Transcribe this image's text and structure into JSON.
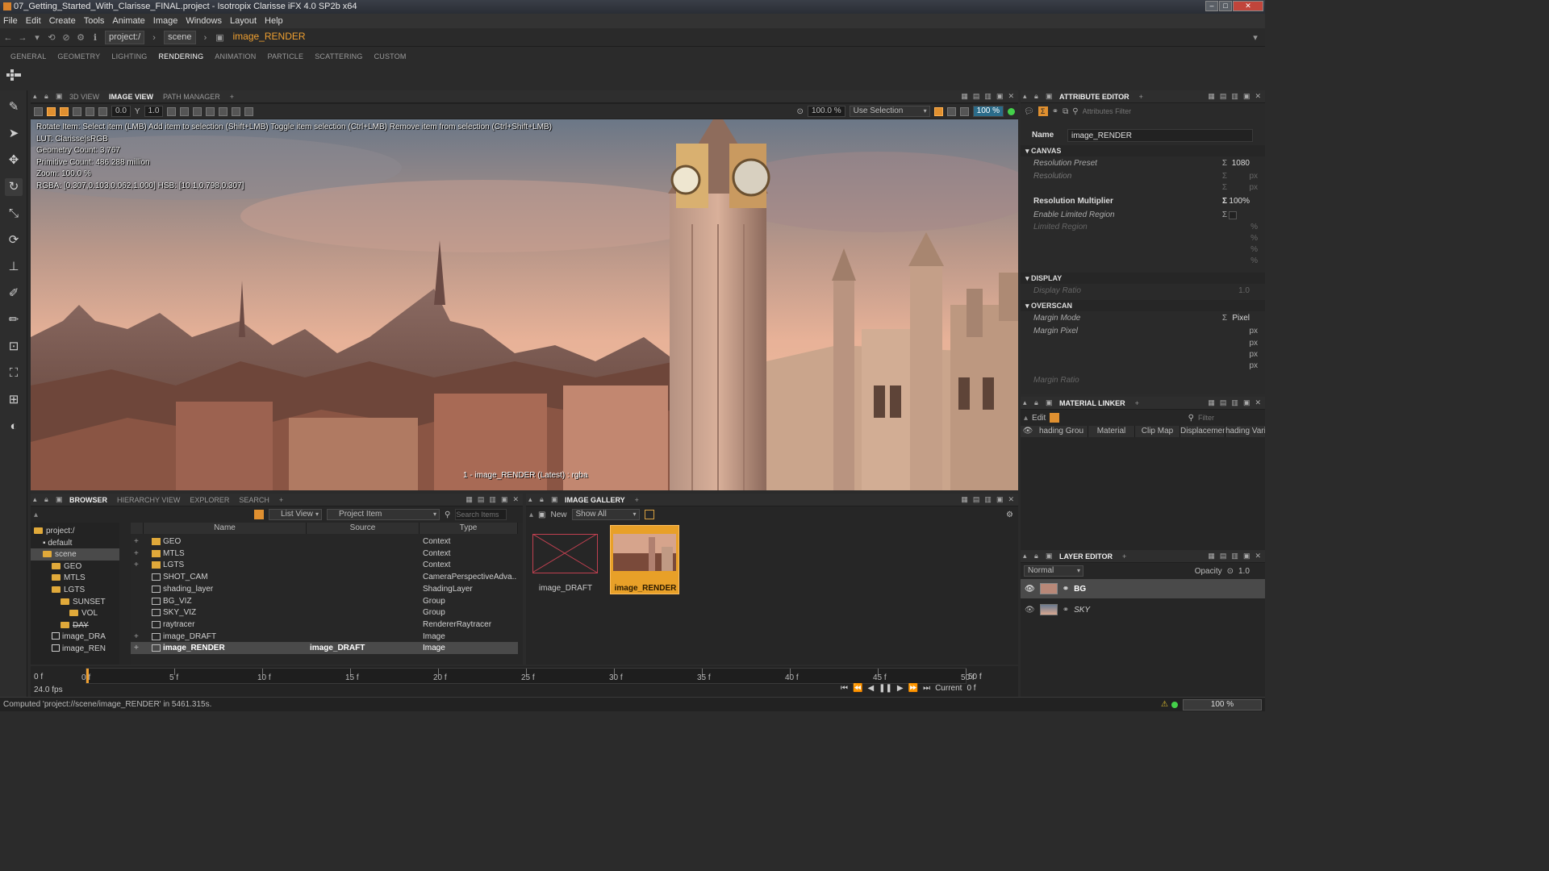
{
  "app": {
    "title": "07_Getting_Started_With_Clarisse_FINAL.project - Isotropix Clarisse iFX 4.0 SP2b x64",
    "window_buttons": [
      "–",
      "□",
      "✕"
    ]
  },
  "menu": [
    "File",
    "Edit",
    "Create",
    "Tools",
    "Animate",
    "Image",
    "Windows",
    "Layout",
    "Help"
  ],
  "path": {
    "crumbs": [
      "project:/",
      "scene"
    ],
    "current": "image_RENDER"
  },
  "shelf_tabs": [
    "GENERAL",
    "GEOMETRY",
    "LIGHTING",
    "RENDERING",
    "ANIMATION",
    "PARTICLE",
    "SCATTERING",
    "CUSTOM"
  ],
  "shelf_active": "RENDERING",
  "viewer": {
    "tabs": [
      "3D VIEW",
      "IMAGE VIEW",
      "PATH MANAGER"
    ],
    "active_tab": "IMAGE VIEW",
    "toolbar": {
      "exposure": "0.0",
      "gamma": "1.0",
      "zoom": "100.0 %",
      "selection": "Use Selection",
      "percent": "100 %"
    },
    "overlay": [
      "Rotate Item: Select item (LMB)  Add item to selection (Shift+LMB)  Toggle item selection (Ctrl+LMB)  Remove item from selection (Ctrl+Shift+LMB)",
      "LUT: Clarisse|sRGB",
      "Geometry Count: 3,767",
      "Primitive Count: 486.288 million",
      "Zoom: 100.0 %",
      "RGBA: [0.307,0.103,0.062,1.000] HSB: [10.1,0.798,0.307]"
    ],
    "caption": "1 - image_RENDER (Latest) : rgba"
  },
  "browser": {
    "tabs": [
      "BROWSER",
      "HIERARCHY VIEW",
      "EXPLORER",
      "SEARCH"
    ],
    "active_tab": "BROWSER",
    "view_mode": "List View",
    "filter_type": "Project Item",
    "search_placeholder": "Search Items",
    "tree": [
      {
        "label": "project:/",
        "indent": 0
      },
      {
        "label": "default",
        "indent": 1
      },
      {
        "label": "scene",
        "indent": 1
      },
      {
        "label": "GEO",
        "indent": 2
      },
      {
        "label": "MTLS",
        "indent": 2
      },
      {
        "label": "LGTS",
        "indent": 2
      },
      {
        "label": "SUNSET",
        "indent": 3
      },
      {
        "label": "VOL",
        "indent": 4
      },
      {
        "label": "DAY",
        "indent": 3
      },
      {
        "label": "image_DRA",
        "indent": 2
      },
      {
        "label": "image_REN",
        "indent": 2
      }
    ],
    "columns": [
      "Name",
      "Source",
      "Type"
    ],
    "rows": [
      {
        "name": "GEO",
        "source": "",
        "type": "Context",
        "icon": "folder"
      },
      {
        "name": "MTLS",
        "source": "",
        "type": "Context",
        "icon": "folder"
      },
      {
        "name": "LGTS",
        "source": "",
        "type": "Context",
        "icon": "folder"
      },
      {
        "name": "SHOT_CAM",
        "source": "",
        "type": "CameraPerspectiveAdva...",
        "icon": "camera"
      },
      {
        "name": "shading_layer",
        "source": "",
        "type": "ShadingLayer",
        "icon": "layer"
      },
      {
        "name": "BG_VIZ",
        "source": "",
        "type": "Group",
        "icon": "group"
      },
      {
        "name": "SKY_VIZ",
        "source": "",
        "type": "Group",
        "icon": "group"
      },
      {
        "name": "raytracer",
        "source": "",
        "type": "RendererRaytracer",
        "icon": "renderer"
      },
      {
        "name": "image_DRAFT",
        "source": "",
        "type": "Image",
        "icon": "image"
      },
      {
        "name": "image_RENDER",
        "source": "image_DRAFT",
        "type": "Image",
        "icon": "image"
      }
    ]
  },
  "gallery": {
    "tab": "IMAGE GALLERY",
    "new_label": "New",
    "filter": "Show All",
    "items": [
      "image_DRAFT",
      "image_RENDER"
    ]
  },
  "attribute_editor": {
    "tab": "ATTRIBUTE EDITOR",
    "filter_placeholder": "Attributes Filter",
    "name_label": "Name",
    "name_value": "image_RENDER",
    "sections": {
      "canvas": "CANVAS",
      "display": "DISPLAY",
      "overscan": "OVERSCAN"
    },
    "attrs": {
      "resolution_preset": "Resolution Preset",
      "resolution_preset_value": "1080",
      "resolution": "Resolution",
      "resolution_multiplier": "Resolution Multiplier",
      "resolution_multiplier_value": "100%",
      "enable_limited_region": "Enable Limited Region",
      "limited_region": "Limited Region",
      "display_ratio": "Display Ratio",
      "display_ratio_value": "1.0",
      "margin_mode": "Margin Mode",
      "margin_mode_value": "Pixel",
      "margin_pixel": "Margin Pixel",
      "margin_ratio": "Margin Ratio",
      "px": "px",
      "pct": "%"
    }
  },
  "material_linker": {
    "tab": "MATERIAL LINKER",
    "edit_label": "Edit",
    "filter_placeholder": "Filter",
    "columns": [
      "hading Grou",
      "Material",
      "Clip Map",
      "Displacement",
      "hading Varia"
    ]
  },
  "layer_editor": {
    "tab": "LAYER EDITOR",
    "blend_mode": "Normal",
    "opacity_label": "Opacity",
    "opacity_value": "1.0",
    "layers": [
      "BG",
      "SKY"
    ]
  },
  "timeline": {
    "ticks": [
      "0 f",
      "5 f",
      "10 f",
      "15 f",
      "20 f",
      "25 f",
      "30 f",
      "35 f",
      "40 f",
      "45 f",
      "50 f"
    ],
    "start": "0 f",
    "end": "50 f",
    "fps": "24.0 fps",
    "current_label": "Current",
    "current_value": "0 f"
  },
  "status": {
    "message": "Computed 'project://scene/image_RENDER' in 5461.315s.",
    "zoom": "100 %"
  },
  "colors": {
    "accent": "#f0a030",
    "selection": "#e8a028",
    "bg": "#2b2b2b"
  }
}
